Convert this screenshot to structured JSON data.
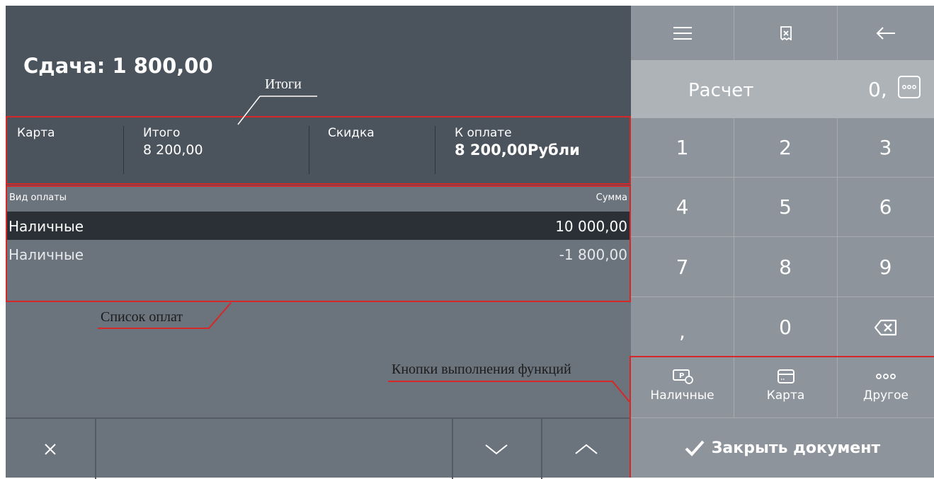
{
  "header": {
    "change_text": "Сдача: 1 800,00"
  },
  "totals": {
    "card_label": "Карта",
    "total_label": "Итого",
    "total_value": "8 200,00",
    "discount_label": "Скидка",
    "due_label": "К оплате",
    "due_value": "8 200,00Рубли"
  },
  "payments": {
    "col_type": "Вид оплаты",
    "col_amount": "Сумма",
    "rows": [
      {
        "type": "Наличные",
        "amount": "10 000,00",
        "selected": true
      },
      {
        "type": "Наличные",
        "amount": "-1 800,00",
        "selected": false
      }
    ]
  },
  "annotations": {
    "totals": "Итоги",
    "payments_list": "Список оплат",
    "function_buttons": "Кнопки выполнения функций"
  },
  "toolbar": {
    "icons": [
      "menu-icon",
      "receipt-cancel-icon",
      "back-arrow-icon"
    ]
  },
  "calculator": {
    "label": "Расчет",
    "value": "0,"
  },
  "keypad": {
    "keys": [
      "1",
      "2",
      "3",
      "4",
      "5",
      "6",
      "7",
      "8",
      "9",
      ",",
      "0"
    ]
  },
  "payment_methods": {
    "cash": "Наличные",
    "card": "Карта",
    "other": "Другое"
  },
  "actions": {
    "close_document": "Закрыть документ"
  },
  "colors": {
    "panel_dark": "#4b535c",
    "panel_mid": "#6b737d",
    "keypad": "#8d949b",
    "accent_red": "#d62828",
    "selected_row": "#2a3036"
  }
}
